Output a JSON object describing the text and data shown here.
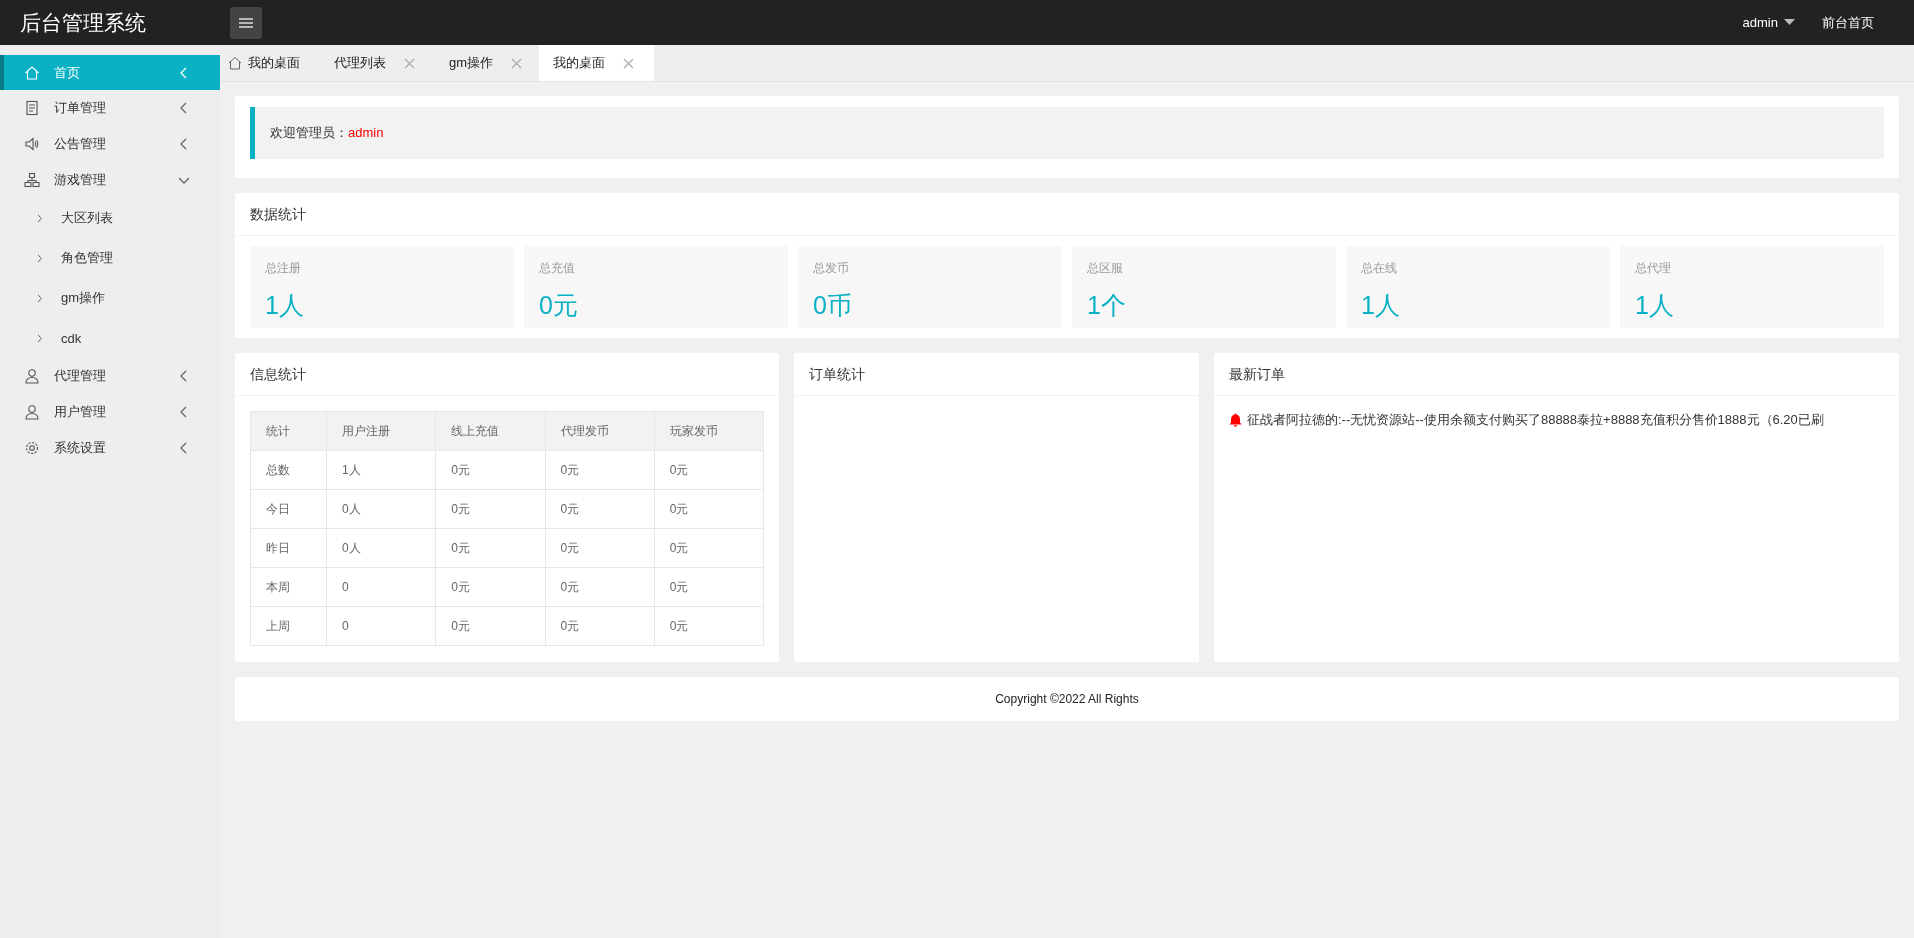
{
  "header": {
    "title": "后台管理系统",
    "user": "admin",
    "home_link": "前台首页"
  },
  "sidebar": {
    "items": [
      {
        "label": "首页",
        "selected": true,
        "expanded": false
      },
      {
        "label": "订单管理",
        "selected": false,
        "expanded": false
      },
      {
        "label": "公告管理",
        "selected": false,
        "expanded": false
      },
      {
        "label": "游戏管理",
        "selected": false,
        "expanded": true,
        "children": [
          {
            "label": "大区列表",
            "selected": false
          },
          {
            "label": "角色管理",
            "selected": false
          },
          {
            "label": "gm操作",
            "selected": false
          },
          {
            "label": "cdk",
            "selected": false
          }
        ]
      },
      {
        "label": "代理管理",
        "selected": false,
        "expanded": false
      },
      {
        "label": "用户管理",
        "selected": false,
        "expanded": false
      },
      {
        "label": "系统设置",
        "selected": false,
        "expanded": false
      }
    ]
  },
  "tabs": [
    {
      "label": "我的桌面",
      "kind": "home",
      "selected": false
    },
    {
      "label": "代理列表",
      "kind": "page",
      "selected": false
    },
    {
      "label": "gm操作",
      "kind": "page",
      "selected": false
    },
    {
      "label": "我的桌面",
      "kind": "page",
      "selected": true
    }
  ],
  "welcome": {
    "label": "欢迎管理员：",
    "user": "admin"
  },
  "data_stats": {
    "title": "数据统计",
    "cards": [
      {
        "label": "总注册",
        "value": "1人"
      },
      {
        "label": "总充值",
        "value": "0元"
      },
      {
        "label": "总发币",
        "value": "0币"
      },
      {
        "label": "总区服",
        "value": "1个"
      },
      {
        "label": "总在线",
        "value": "1人"
      },
      {
        "label": "总代理",
        "value": "1人"
      }
    ]
  },
  "info_stats": {
    "title": "信息统计",
    "table": {
      "columns": [
        "统计",
        "用户注册",
        "线上充值",
        "代理发币",
        "玩家发币"
      ],
      "rows": [
        [
          "总数",
          "1人",
          "0元",
          "0元",
          "0元"
        ],
        [
          "今日",
          "0人",
          "0元",
          "0元",
          "0元"
        ],
        [
          "昨日",
          "0人",
          "0元",
          "0元",
          "0元"
        ],
        [
          "本周",
          "0",
          "0元",
          "0元",
          "0元"
        ],
        [
          "上周",
          "0",
          "0元",
          "0元",
          "0元"
        ]
      ]
    }
  },
  "order_stats": {
    "title": "订单统计"
  },
  "latest_orders": {
    "title": "最新订单",
    "items": [
      {
        "text": "征战者阿拉德的:--无忧资源站--使用余额支付购买了88888泰拉+8888充值积分售价1888元（6.20已刷"
      }
    ]
  },
  "footer": "Copyright ©2022 All Rights"
}
